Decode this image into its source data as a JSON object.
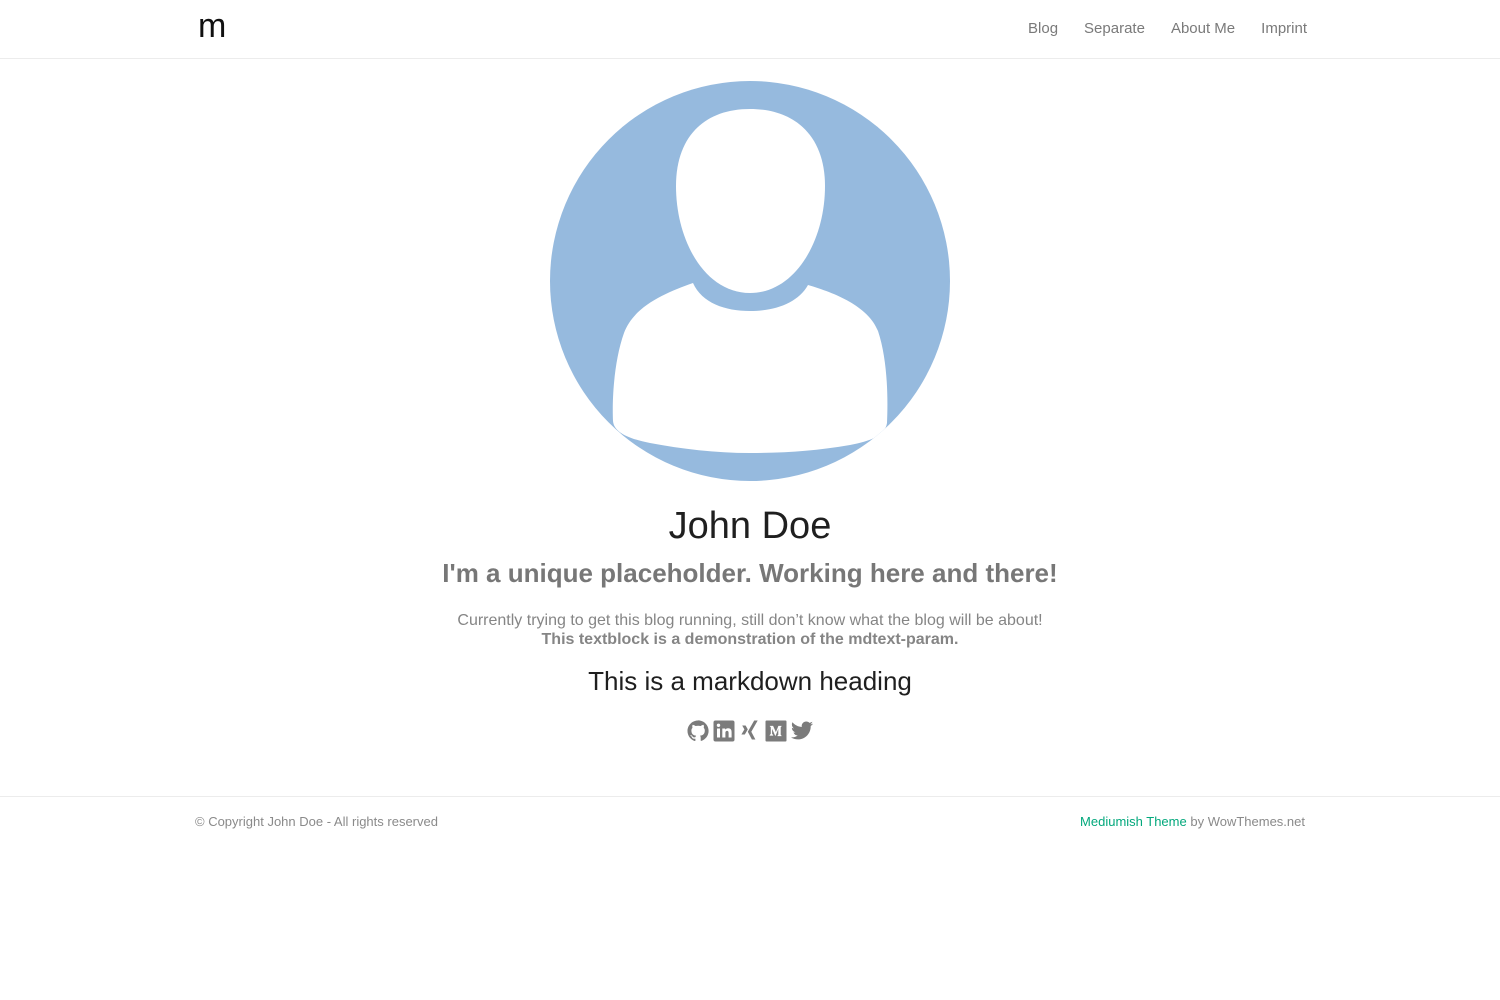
{
  "navbar": {
    "brand": "m",
    "links": [
      "Blog",
      "Separate",
      "About Me",
      "Imprint"
    ]
  },
  "profile": {
    "name": "John Doe",
    "tagline": "I'm a unique placeholder. Working here and there!",
    "description_line1": "Currently trying to get this blog running, still don’t know what the blog will be about!",
    "description_line2": "This textblock is a demonstration of the mdtext-param.",
    "markdown_heading": "This is a markdown heading",
    "avatar_icon": "user-silhouette-icon",
    "avatar_color": "#96bade"
  },
  "socials": [
    {
      "icon": "github-icon"
    },
    {
      "icon": "linkedin-icon"
    },
    {
      "icon": "xing-icon"
    },
    {
      "icon": "medium-icon"
    },
    {
      "icon": "twitter-icon"
    }
  ],
  "footer": {
    "copyright": "© Copyright John Doe - All rights reserved",
    "theme_link": "Mediumish Theme",
    "by_text": " by WowThemes.net",
    "accent_color": "#03a87c"
  }
}
